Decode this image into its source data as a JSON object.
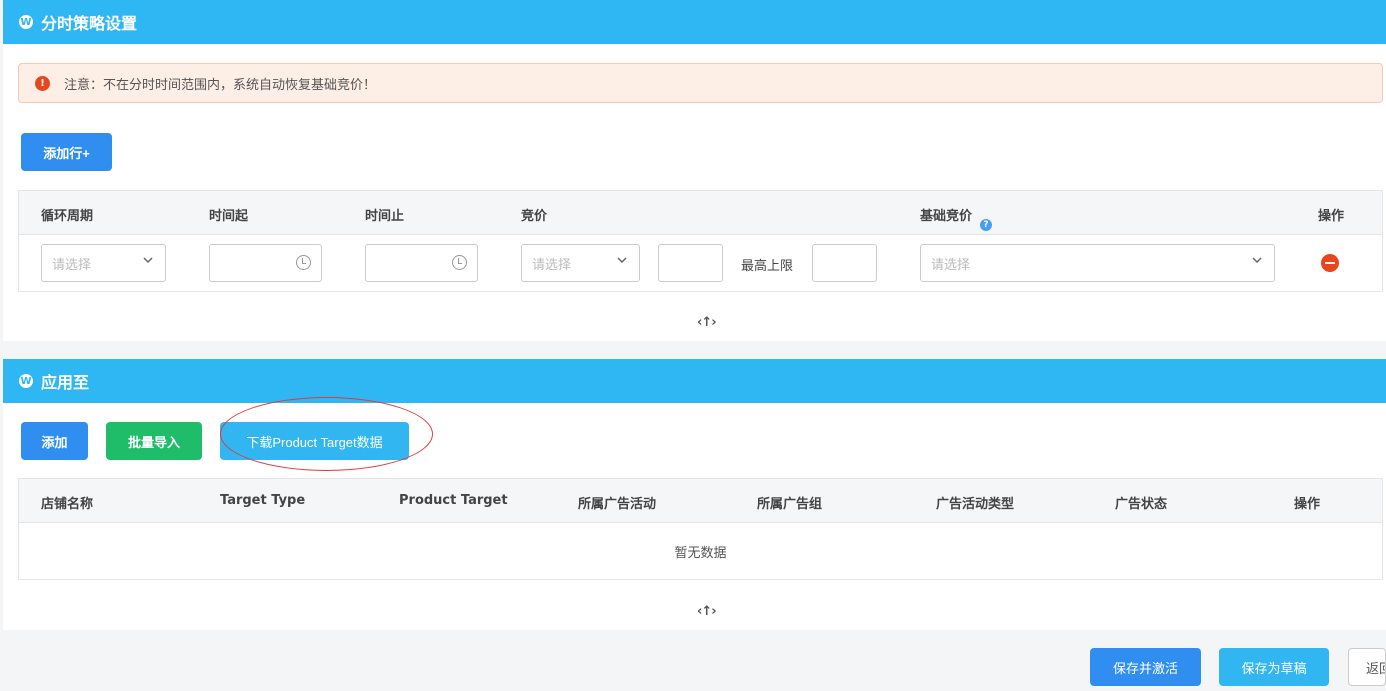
{
  "strategy": {
    "title": "分时策略设置",
    "notice": "注意：不在分时时间范围内，系统自动恢复基础竞价！",
    "add_row": "添加行+",
    "headers": [
      "循环周期",
      "时间起",
      "时间止",
      "竞价",
      "基础竞价",
      "操作"
    ],
    "row": {
      "cycle_placeholder": "请选择",
      "bid_placeholder": "请选择",
      "max_label": "最高上限",
      "base_bid_placeholder": "请选择"
    },
    "collapse": "‹↑›"
  },
  "apply": {
    "title": "应用至",
    "buttons": {
      "add": "添加",
      "batch_import": "批量导入",
      "download": "下载Product Target数据"
    },
    "headers": [
      "店铺名称",
      "Target Type",
      "Product Target",
      "所属广告活动",
      "所属广告组",
      "广告活动类型",
      "广告状态",
      "操作"
    ],
    "empty": "暂无数据",
    "collapse": "‹↑›"
  },
  "footer": {
    "save_activate": "保存并激活",
    "save_draft": "保存为草稿",
    "back": "返回"
  },
  "colors": {
    "header": "#2fb7f3",
    "primary": "#2f8ef0",
    "success": "#1fbd6a",
    "danger": "#e8461e"
  }
}
